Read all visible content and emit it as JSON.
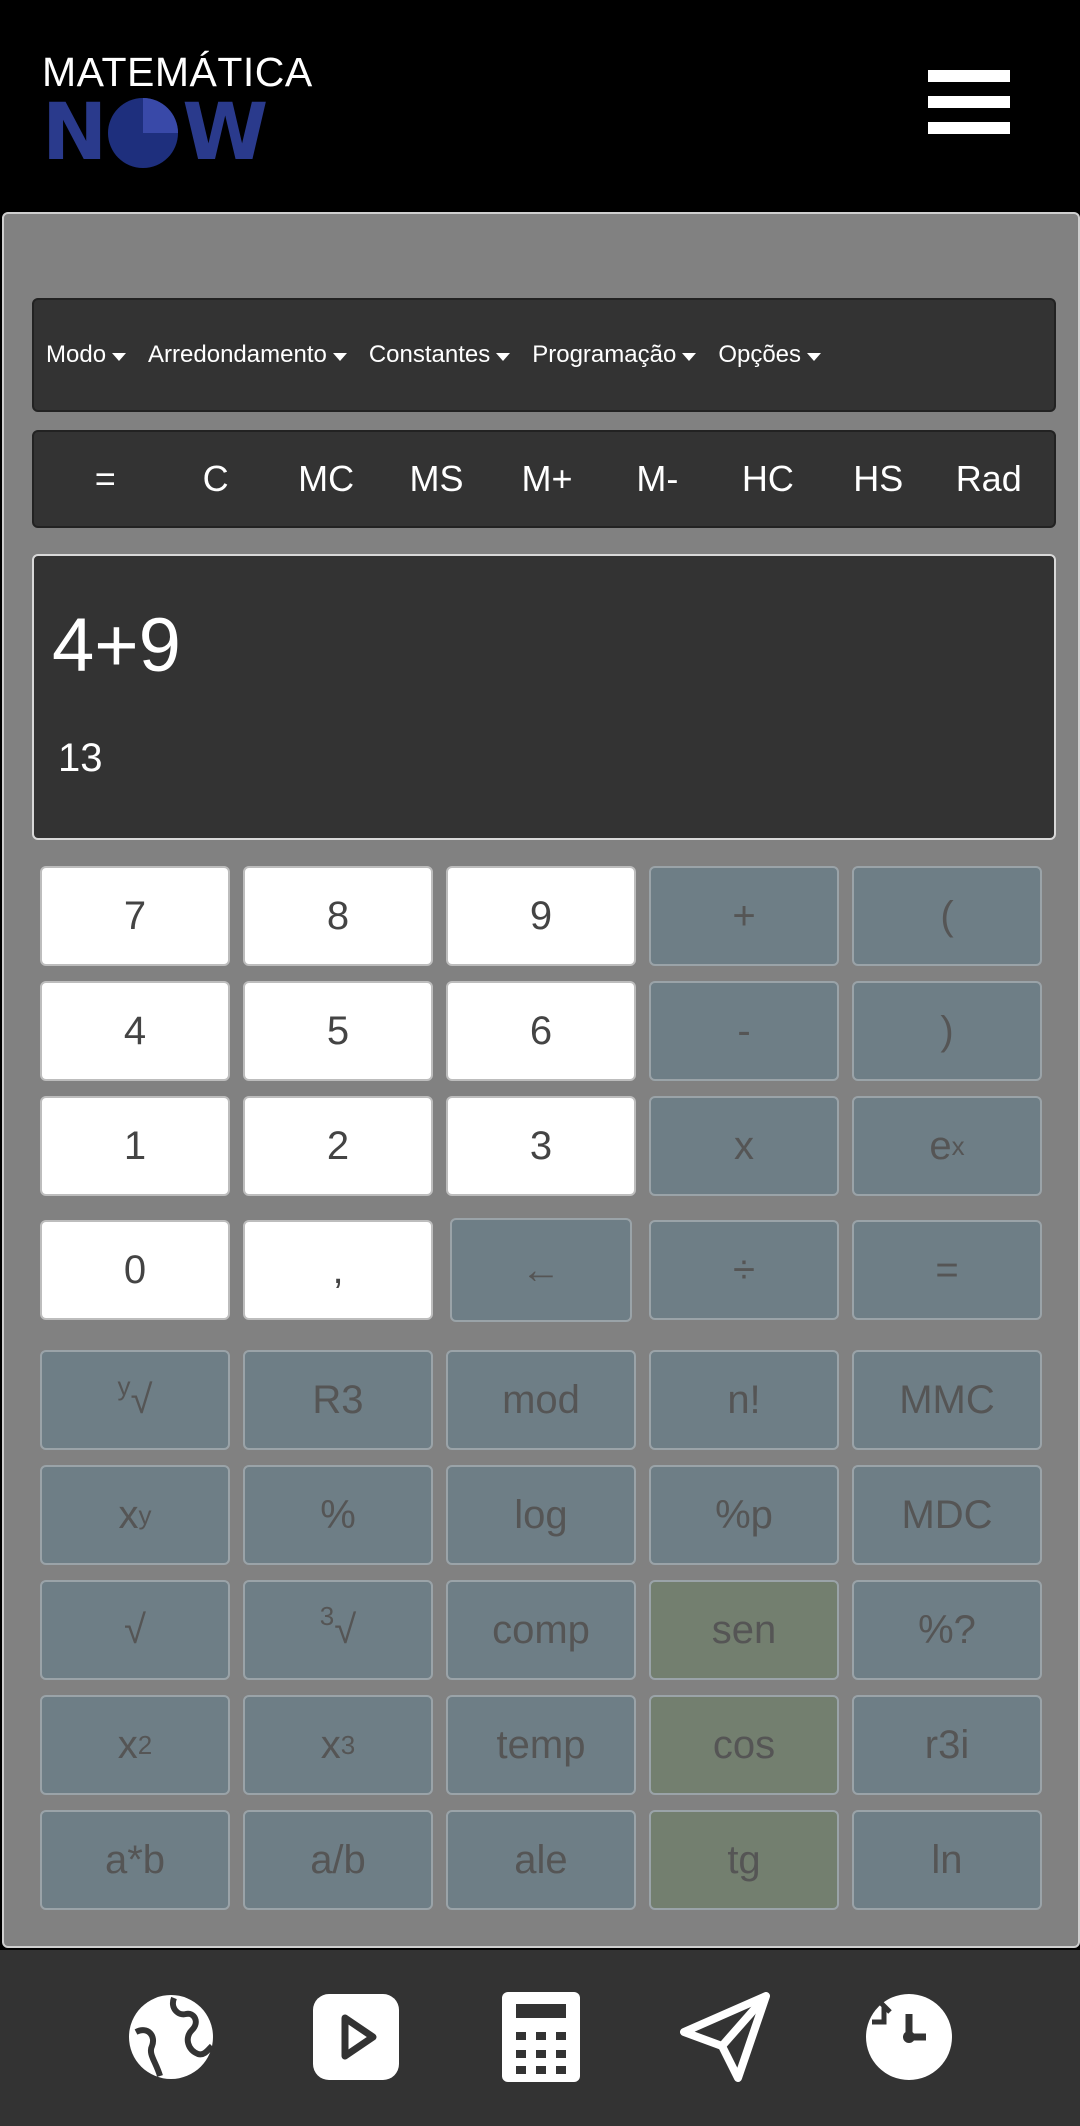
{
  "header": {
    "logo_top": "MATEMÁTICA",
    "logo_bottom": "NOW"
  },
  "menubar": [
    "Modo",
    "Arredondamento",
    "Constantes",
    "Programação",
    "Opções"
  ],
  "memory_buttons": [
    "=",
    "C",
    "MC",
    "MS",
    "M+",
    "M-",
    "HC",
    "HS",
    "Rad"
  ],
  "display": {
    "expression": "4+9",
    "result": "13"
  },
  "keys": {
    "k7": "7",
    "k8": "8",
    "k9": "9",
    "plus": "+",
    "lparen": "(",
    "k4": "4",
    "k5": "5",
    "k6": "6",
    "minus": "-",
    "rparen": ")",
    "k1": "1",
    "k2": "2",
    "k3": "3",
    "times": "x",
    "exp_base": "e",
    "exp_sup": "x",
    "k0": "0",
    "comma": ",",
    "backspace": "←",
    "divide": "÷",
    "equals": "=",
    "root_y_pre": "y",
    "root_y_sym": "√",
    "r3": "R3",
    "mod": "mod",
    "fact": "n!",
    "mmc": "MMC",
    "pow_base": "x",
    "pow_sup": "y",
    "percent": "%",
    "log": "log",
    "percent_p": "%p",
    "mdc": "MDC",
    "sqrt": "√",
    "cbrt_pre": "3",
    "cbrt_sym": "√",
    "comp": "comp",
    "sen": "sen",
    "percent_q": "%?",
    "sq_base": "x",
    "sq_sup": "2",
    "cube_base": "x",
    "cube_sup": "3",
    "temp": "temp",
    "cos": "cos",
    "r3i": "r3i",
    "ab": "a*b",
    "adivb": "a/b",
    "ale": "ale",
    "tg": "tg",
    "ln": "ln"
  },
  "bottom_nav": [
    "globe-icon",
    "play-icon",
    "calculator-icon",
    "send-icon",
    "timer-icon"
  ]
}
